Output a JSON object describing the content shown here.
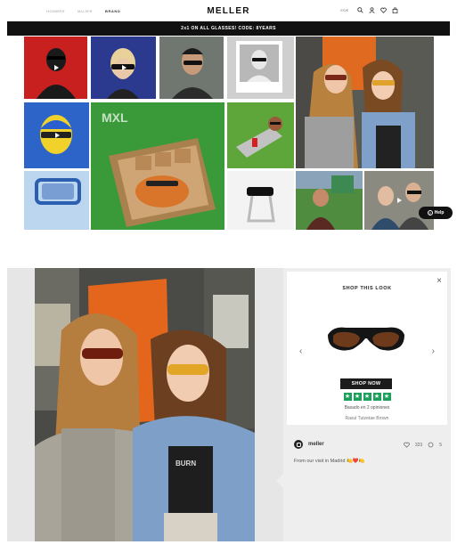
{
  "site": {
    "nav_links": [
      "HOMBRE",
      "MUJER",
      "BRAND"
    ],
    "brand": "MELLER",
    "lang": "ES/€",
    "promo": "2x1 ON ALL GLASSES! CODE: 8YEARS",
    "help_label": "Help"
  },
  "shop_the_look": {
    "title": "SHOP THIS LOOK",
    "close": "×",
    "prev": "‹",
    "next": "›",
    "button": "SHOP NOW",
    "stars": 5,
    "rating_text": "Basado en 2 opiniones",
    "product_name": "Rasul Tutzetae Brown"
  },
  "post": {
    "username": "meller",
    "likes": "323",
    "comments": "5",
    "caption": "From our visit in Madrid 🍋❤️🍋"
  },
  "icons": [
    "search-icon",
    "user-icon",
    "heart-icon",
    "bag-icon",
    "play-icon",
    "instagram-icon",
    "heart-outline-icon",
    "comment-icon"
  ],
  "colors": {
    "promo_bar": "#111111",
    "star_green": "#1aa05a",
    "button": "#1c1c1c"
  }
}
